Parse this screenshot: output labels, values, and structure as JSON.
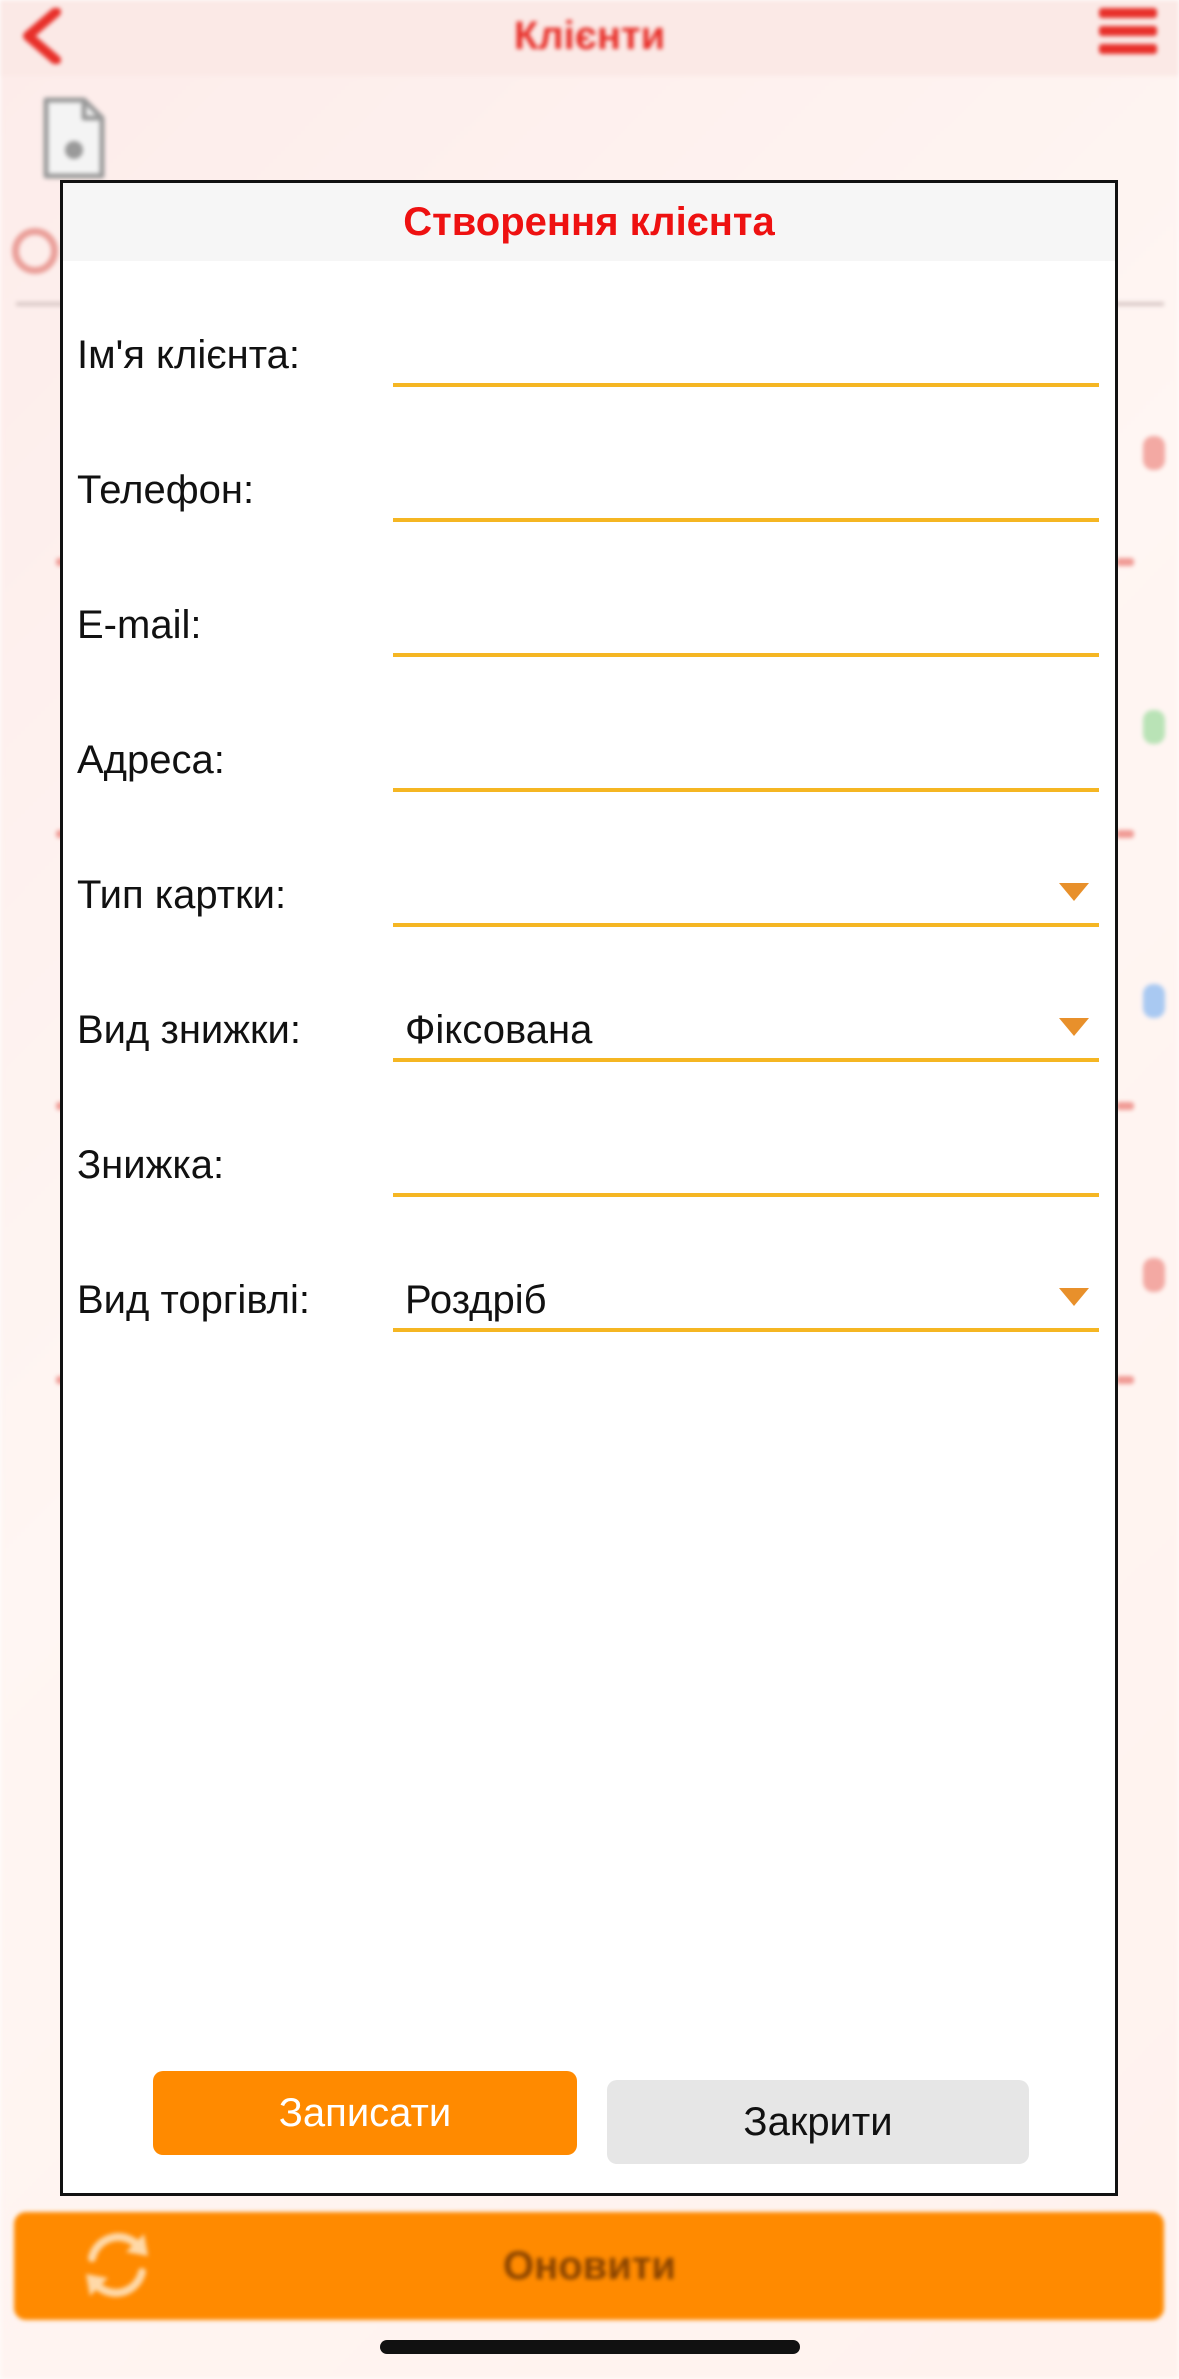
{
  "background": {
    "title": "Клієнти",
    "refresh_label": "Оновити"
  },
  "dialog": {
    "title": "Створення клієнта",
    "fields": [
      {
        "label": "Ім'я клієнта:",
        "value": "",
        "type": "text"
      },
      {
        "label": "Телефон:",
        "value": "",
        "type": "text"
      },
      {
        "label": "E-mail:",
        "value": "",
        "type": "text"
      },
      {
        "label": "Адреса:",
        "value": "",
        "type": "text"
      },
      {
        "label": "Тип картки:",
        "value": "",
        "type": "dropdown"
      },
      {
        "label": "Вид знижки:",
        "value": "Фіксована",
        "type": "dropdown"
      },
      {
        "label": "Знижка:",
        "value": "",
        "type": "text"
      },
      {
        "label": "Вид торгівлі:",
        "value": "Роздріб",
        "type": "dropdown"
      }
    ],
    "save_label": "Записати",
    "close_label": "Закрити"
  },
  "colors": {
    "accent_orange": "#ff8a00",
    "title_red": "#ee1111",
    "underline_yellow": "#f5b623",
    "arrow_orange": "#e8902b"
  }
}
